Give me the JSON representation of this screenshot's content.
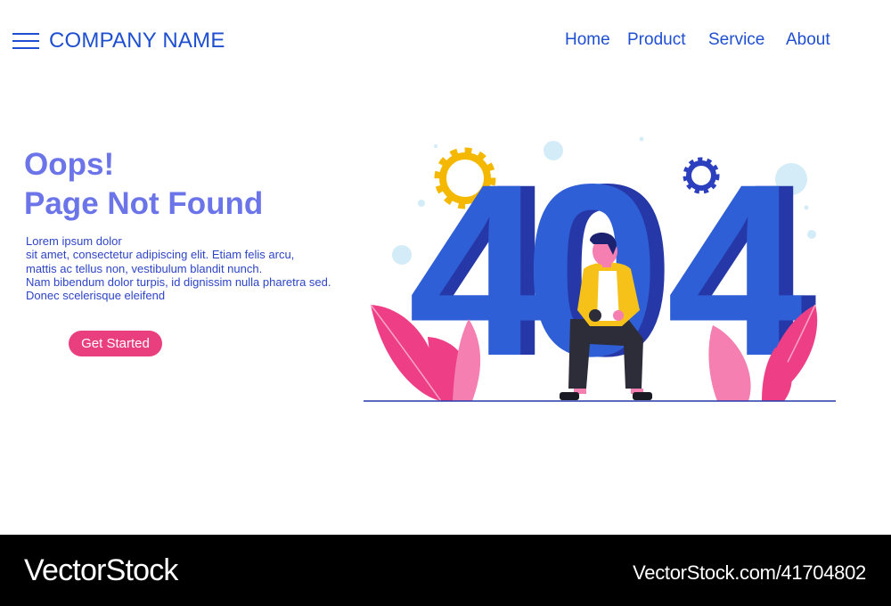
{
  "header": {
    "brand": "COMPANY NAME",
    "menu_icon": "hamburger-menu-icon",
    "nav": [
      "Home",
      "Product",
      "Service",
      "About"
    ]
  },
  "hero": {
    "title_line1": "Oops!",
    "title_line2": "Page Not Found",
    "body_lines": [
      "Lorem ipsum dolor",
      "sit amet, consectetur adipiscing elit. Etiam felis arcu,",
      "mattis ac tellus non, vestibulum blandit nunch.",
      "Nam bibendum dolor turpis, id dignissim nulla pharetra sed.",
      "Donec scelerisque eleifend"
    ],
    "cta_label": "Get Started"
  },
  "illustration": {
    "error_code_digits": [
      "4",
      "0",
      "4"
    ],
    "icons": [
      "gear-icon",
      "gear-icon",
      "leaf-plant-icon",
      "person-sitting-icon"
    ]
  },
  "watermark": {
    "logo": "VectorStock",
    "logo_registered": "®",
    "url": "VectorStock.com/41704802"
  },
  "colors": {
    "brand_blue": "#1f4fd1",
    "title_purple": "#6b74e8",
    "digit_front": "#2f5fd6",
    "digit_side": "#2638a8",
    "cta_pink": "#ea3f7f",
    "gear_yellow": "#f5b800",
    "gear_blue": "#2c3fbe",
    "leaf_pink": "#ee3e86",
    "leaf_light_pink": "#f47fb0",
    "bubble": "#d3ecf8",
    "jacket_yellow": "#f6c21a"
  }
}
